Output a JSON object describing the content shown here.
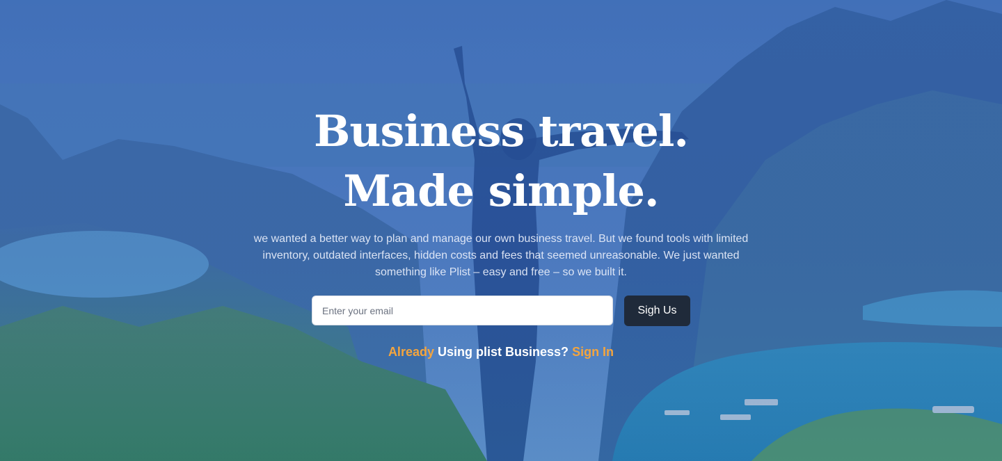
{
  "hero": {
    "title_line1": "Business travel.",
    "title_line2": "Made simple.",
    "description": "we wanted a better way to plan and manage our own business travel. But we found tools with limited inventory, outdated interfaces, hidden costs and fees that seemed unreasonable. We just wanted something like Plist – easy and free – so we built it.",
    "email_placeholder": "Enter your email",
    "signup_label": "Sigh Us",
    "signin_prefix": "Already",
    "signin_middle": "Using plist Business?",
    "signin_link": "Sign In"
  },
  "colors": {
    "overlay": "#2c56a0",
    "accent": "#f4a53e",
    "button_bg": "#1f2a3a",
    "text": "#ffffff"
  },
  "background": {
    "image": "mountain-landscape-with-woman-raising-arms"
  }
}
